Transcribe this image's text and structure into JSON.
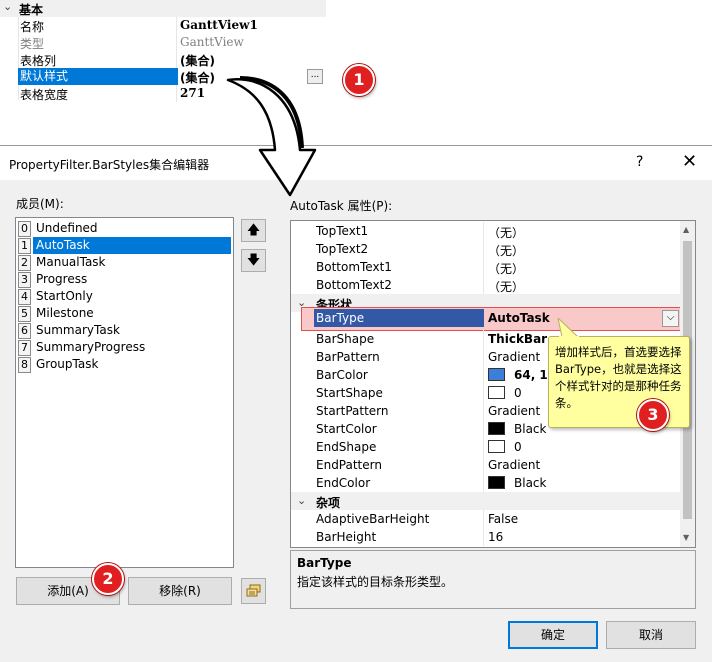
{
  "top_grid": {
    "category": "基本",
    "rows": [
      {
        "key": "名称",
        "value": "GanttView1"
      },
      {
        "key": "类型",
        "value": "GanttView"
      },
      {
        "key": "表格列",
        "value": "(集合)"
      },
      {
        "key": "默认样式",
        "value": "(集合)"
      },
      {
        "key": "表格宽度",
        "value": "271"
      }
    ],
    "ellipsis": "..."
  },
  "badges": [
    "1",
    "2",
    "3"
  ],
  "dialog": {
    "title": "PropertyFilter.BarStyles集合编辑器",
    "help": "?",
    "close": "✕",
    "members_label": "成员(M):",
    "members": [
      {
        "index": "0",
        "name": "Undefined"
      },
      {
        "index": "1",
        "name": "AutoTask"
      },
      {
        "index": "2",
        "name": "ManualTask"
      },
      {
        "index": "3",
        "name": "Progress"
      },
      {
        "index": "4",
        "name": "StartOnly"
      },
      {
        "index": "5",
        "name": "Milestone"
      },
      {
        "index": "6",
        "name": "SummaryTask"
      },
      {
        "index": "7",
        "name": "SummaryProgress"
      },
      {
        "index": "8",
        "name": "GroupTask"
      }
    ],
    "selected_member": "AutoTask",
    "up_arrow": "🡅",
    "down_arrow": "🡇",
    "add_button": "添加(A)",
    "remove_button": "移除(R)",
    "props_label": "AutoTask 属性(P):",
    "properties_top": [
      {
        "key": "TopText1",
        "value": "（无）"
      },
      {
        "key": "TopText2",
        "value": "（无）"
      },
      {
        "key": "BottomText1",
        "value": "（无）"
      },
      {
        "key": "BottomText2",
        "value": "（无）"
      }
    ],
    "category_bar": "条形状",
    "bar_type": {
      "key": "BarType",
      "value": "AutoTask"
    },
    "properties_bar": [
      {
        "key": "BarShape",
        "value": "ThickBar",
        "bold": true
      },
      {
        "key": "BarPattern",
        "value": "Gradient"
      },
      {
        "key": "BarColor",
        "value": "64, 1",
        "swatch": "#3c7fd8",
        "bold": true
      },
      {
        "key": "StartShape",
        "value": "0",
        "swatch": "#ffffff"
      },
      {
        "key": "StartPattern",
        "value": "Gradient"
      },
      {
        "key": "StartColor",
        "value": "Black",
        "swatch": "#000000"
      },
      {
        "key": "EndShape",
        "value": "0",
        "swatch": "#ffffff"
      },
      {
        "key": "EndPattern",
        "value": "Gradient"
      },
      {
        "key": "EndColor",
        "value": "Black",
        "swatch": "#000000"
      }
    ],
    "category_misc": "杂项",
    "properties_misc": [
      {
        "key": "AdaptiveBarHeight",
        "value": "False"
      },
      {
        "key": "BarHeight",
        "value": "16"
      }
    ],
    "desc_title": "BarType",
    "desc_text": "指定该样式的目标条形类型。",
    "ok_button": "确定",
    "cancel_button": "取消"
  },
  "callout_text": "增加样式后，首选要选择BarType，也就是选择这个样式针对的是那种任务条。",
  "colors": {
    "accent": "#0078d7",
    "badge": "#e02020",
    "callout": "#ffffa0",
    "highlight": "#f9c8c8"
  }
}
